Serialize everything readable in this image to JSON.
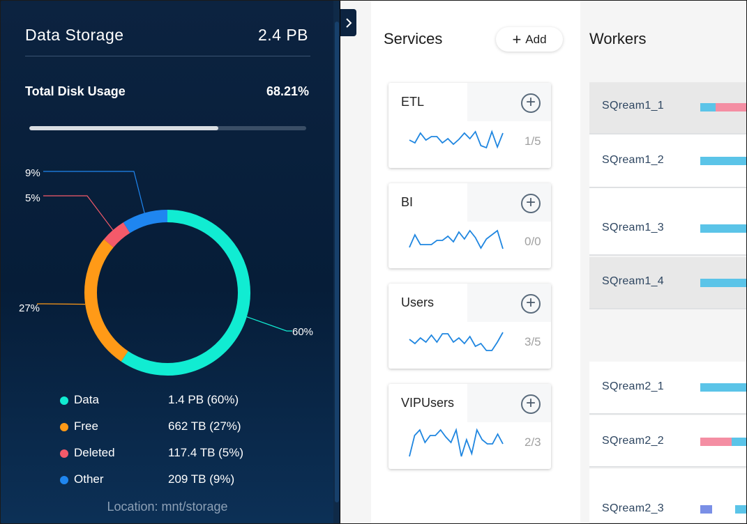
{
  "storage": {
    "title": "Data Storage",
    "total": "2.4 PB",
    "disk_usage_label": "Total Disk Usage",
    "disk_usage_value": "68.21%",
    "disk_usage_fraction": 0.6821,
    "location": "Location: mnt/storage",
    "slices": [
      {
        "name": "Data",
        "percent": 60,
        "label": "60%",
        "value": "1.4 PB (60%)",
        "color": "#11ecd2"
      },
      {
        "name": "Free",
        "percent": 27,
        "label": "27%",
        "value": "662 TB (27%)",
        "color": "#ff9a17"
      },
      {
        "name": "Deleted",
        "percent": 5,
        "label": "5%",
        "value": "117.4 TB (5%)",
        "color": "#f45a6a"
      },
      {
        "name": "Other",
        "percent": 9,
        "label": "9%",
        "value": "209 TB (9%)",
        "color": "#1f86f0"
      }
    ]
  },
  "services": {
    "title": "Services",
    "add_label": "Add",
    "items": [
      {
        "name": "ETL",
        "count": "1/5",
        "spark": [
          22,
          26,
          12,
          22,
          17,
          17,
          26,
          20,
          28,
          21,
          12,
          20,
          10,
          30,
          33,
          10,
          32,
          12
        ]
      },
      {
        "name": "BI",
        "count": "0/0",
        "spark": [
          32,
          14,
          28,
          28,
          28,
          22,
          22,
          16,
          24,
          10,
          20,
          8,
          18,
          33,
          20,
          14,
          8,
          34
        ]
      },
      {
        "name": "Users",
        "count": "3/5",
        "spark": [
          20,
          26,
          18,
          24,
          14,
          24,
          12,
          12,
          24,
          18,
          26,
          16,
          30,
          26,
          36,
          36,
          24,
          10
        ]
      },
      {
        "name": "VIPUsers",
        "count": "2/3",
        "spark": [
          44,
          14,
          6,
          24,
          14,
          14,
          6,
          16,
          24,
          6,
          44,
          20,
          40,
          6,
          20,
          26,
          26,
          12,
          26
        ]
      }
    ]
  },
  "workers": {
    "title": "Workers",
    "items": [
      {
        "name": "SQream1_1",
        "selected": true,
        "bar": [
          "#5bc4e8",
          "#f48ea3",
          "#f48ea3"
        ]
      },
      {
        "name": "SQream1_2",
        "selected": false,
        "bar": [
          "#5bc4e8"
        ]
      },
      {
        "name": "SQream1_3",
        "selected": false,
        "bar": [
          "#5bc4e8"
        ]
      },
      {
        "name": "SQream1_4",
        "selected": true,
        "bar": [
          "#5bc4e8"
        ]
      },
      {
        "name": "SQream2_1",
        "selected": false,
        "bar": [
          "#5bc4e8"
        ]
      },
      {
        "name": "SQream2_2",
        "selected": false,
        "bar": [
          "#f48ea3",
          "#f48ea3",
          "#5bc4e8"
        ]
      },
      {
        "name": "SQream2_3",
        "selected": false,
        "bar": [
          "#7a8fe6",
          "#ffffff",
          "#ffffff",
          "#5bc4e8"
        ]
      }
    ]
  }
}
